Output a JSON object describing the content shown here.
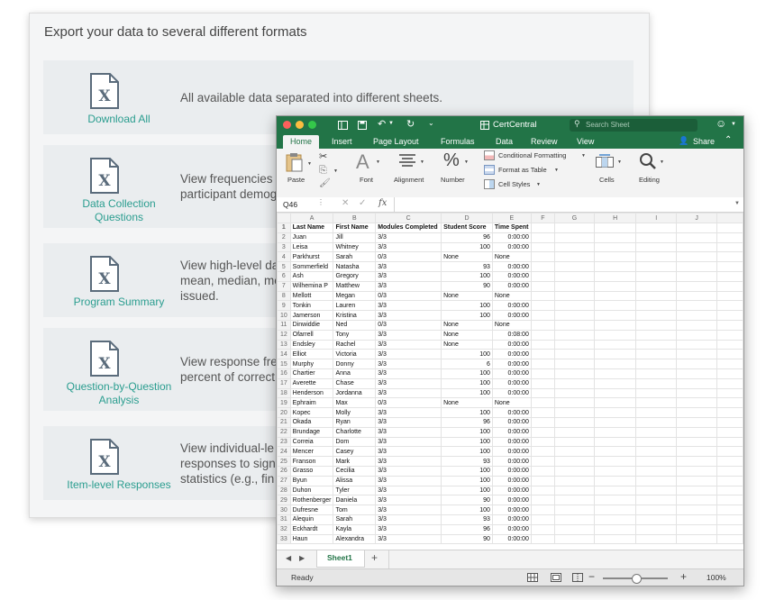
{
  "panel": {
    "title": "Export your data to several different formats",
    "cards": [
      {
        "label": "Download All",
        "desc": "All available data separated into different sheets."
      },
      {
        "label": "Data Collection Questions",
        "desc": "View frequencies\nparticipant demog"
      },
      {
        "label": "Program Summary",
        "desc": "View high-level da\nmean, median, mo\nissued."
      },
      {
        "label": "Question-by-Question Analysis",
        "desc": "View response fre\npercent of correct"
      },
      {
        "label": "Item-level Responses",
        "desc": "View individual-le\nresponses to sign\nstatistics (e.g., fin"
      }
    ],
    "file_icon": "excel-x-file-icon"
  },
  "excel": {
    "title": "CertCentral",
    "search_placeholder": "Search Sheet",
    "share_label": "Share",
    "ribbon_tabs": [
      "Home",
      "Insert",
      "Page Layout",
      "Formulas",
      "Data",
      "Review",
      "View"
    ],
    "active_tab": "Home",
    "ribbon": {
      "paste": "Paste",
      "font": "Font",
      "alignment": "Alignment",
      "number": "Number",
      "conditional_formatting": "Conditional Formatting",
      "format_as_table": "Format as Table",
      "cell_styles": "Cell Styles",
      "cells": "Cells",
      "editing": "Editing"
    },
    "name_box": "Q46",
    "fx": "fx",
    "columns": [
      "A",
      "B",
      "C",
      "D",
      "E",
      "F",
      "G",
      "H",
      "I",
      "J"
    ],
    "headers": [
      "Last Name",
      "First Name",
      "Modules Completed",
      "Student Score",
      "Time Spent"
    ],
    "rows": [
      [
        "Juan",
        "Jill",
        "3/3",
        "96",
        "0:00:00"
      ],
      [
        "Leisa",
        "Whitney",
        "3/3",
        "100",
        "0:00:00"
      ],
      [
        "Parkhurst",
        "Sarah",
        "0/3",
        "None",
        "None"
      ],
      [
        "Sommerfield",
        "Natasha",
        "3/3",
        "93",
        "0:00:00"
      ],
      [
        " Ash",
        "Gregory",
        "3/3",
        "100",
        "0:00:00"
      ],
      [
        "Wilhemina P",
        "Matthew",
        "3/3",
        "90",
        "0:00:00"
      ],
      [
        "Mellott",
        "Megan",
        "0/3",
        "None",
        "None"
      ],
      [
        "Tonkin",
        "Lauren",
        "3/3",
        "100",
        "0:00:00"
      ],
      [
        "Jamerson",
        "Kristina",
        "3/3",
        "100",
        "0:00:00"
      ],
      [
        "Dinwiddie",
        "Ned",
        "0/3",
        "None",
        "None"
      ],
      [
        "Ofarrell",
        "Tony",
        "3/3",
        "None",
        "0:08:00"
      ],
      [
        "Endsley",
        "Rachel",
        "3/3",
        "None",
        "0:00:00"
      ],
      [
        "Elliot",
        "Victoria",
        "3/3",
        "100",
        "0:00:00"
      ],
      [
        "Murphy",
        "Donny",
        "3/3",
        "6",
        "0:00:00"
      ],
      [
        "Chartier",
        "Anna",
        "3/3",
        "100",
        "0:00:00"
      ],
      [
        "Averette",
        "Chase",
        "3/3",
        "100",
        "0:00:00"
      ],
      [
        "Henderson",
        "Jordanna",
        "3/3",
        "100",
        "0:00:00"
      ],
      [
        "Ephraim",
        "Max",
        "0/3",
        "None",
        "None"
      ],
      [
        "Kopec",
        "Molly",
        "3/3",
        "100",
        "0:00:00"
      ],
      [
        "Okada",
        "Ryan",
        "3/3",
        "96",
        "0:00:00"
      ],
      [
        "Brundage",
        "Charlotte",
        "3/3",
        "100",
        "0:00:00"
      ],
      [
        "Correia",
        "Dom",
        "3/3",
        "100",
        "0:00:00"
      ],
      [
        "Mencer",
        "Casey",
        "3/3",
        "100",
        "0:00:00"
      ],
      [
        "Franson",
        "Mark",
        "3/3",
        "93",
        "0:00:00"
      ],
      [
        "Grasso",
        "Cecilia",
        "3/3",
        "100",
        "0:00:00"
      ],
      [
        "Byun",
        "Alissa",
        "3/3",
        "100",
        "0:00:00"
      ],
      [
        "Duhon",
        "Tyler",
        "3/3",
        "100",
        "0:00:00"
      ],
      [
        "Rothenberger",
        "Daniela",
        "3/3",
        "90",
        "0:00:00"
      ],
      [
        "Dufresne",
        "Tom",
        "3/3",
        "100",
        "0:00:00"
      ],
      [
        "Alequin",
        "Sarah",
        "3/3",
        "93",
        "0:00:00"
      ],
      [
        "Eckhardt",
        "Kayla",
        "3/3",
        "96",
        "0:00:00"
      ],
      [
        "Haun",
        "Alexandra",
        "3/3",
        "90",
        "0:00:00"
      ]
    ],
    "sheet_tab": "Sheet1",
    "status": "Ready",
    "zoom": "100%",
    "colors": {
      "accent": "#227447",
      "teal": "#2a9d8f"
    }
  }
}
